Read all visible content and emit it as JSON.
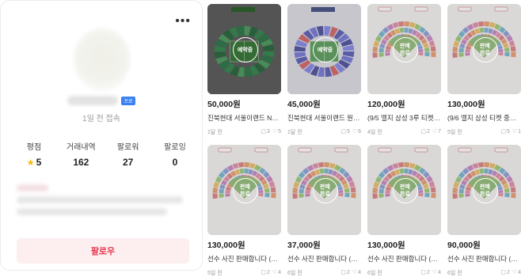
{
  "profile": {
    "menu_icon": "more-horizontal-icon",
    "badge_label": "프로",
    "last_seen": "1일 전 접속",
    "stats": [
      {
        "label": "평점",
        "value": "5",
        "icon": "star-icon"
      },
      {
        "label": "거래내역",
        "value": "162"
      },
      {
        "label": "팔로워",
        "value": "27"
      },
      {
        "label": "팔로잉",
        "value": "0"
      }
    ],
    "follow_label": "팔로우",
    "follow_color": "#e5384f"
  },
  "products": [
    {
      "price": "50,000원",
      "title": "진북현대 서울이랜드 N석 연...",
      "time": "1달 전",
      "chat_count": "3",
      "like_count": "5",
      "status": "예약중",
      "map": "stadium-dark"
    },
    {
      "price": "45,000원",
      "title": "진북현대 서울이랜드 원정석...",
      "time": "1달 전",
      "chat_count": "5",
      "like_count": "6",
      "status": "예약중",
      "map": "stadium-green"
    },
    {
      "price": "120,000원",
      "title": "(9/5 엘지 삼성 3루 티켓 중...",
      "time": "4일 전",
      "chat_count": "2",
      "like_count": "7",
      "status": "판매\n완료",
      "map": "ballpark"
    },
    {
      "price": "130,000원",
      "title": "(9/6 엘지 삼성 티켓 중정)...",
      "time": "5일 전",
      "chat_count": "5",
      "like_count": "1",
      "status": "판매\n완료",
      "map": "ballpark"
    },
    {
      "price": "130,000원",
      "title": "선수 사진 판매합니다 (9/6...",
      "time": "5일 전",
      "chat_count": "2",
      "like_count": "4",
      "status": "판매\n완료",
      "map": "ballpark"
    },
    {
      "price": "37,000원",
      "title": "선수 사진 판매합니다 (9/4...",
      "time": "6일 전",
      "chat_count": "2",
      "like_count": "4",
      "status": "판매\n완료",
      "map": "ballpark"
    },
    {
      "price": "130,000원",
      "title": "선수 사진 판매합니다 (9/4...",
      "time": "6일 전",
      "chat_count": "2",
      "like_count": "4",
      "status": "판매\n완료",
      "map": "ballpark"
    },
    {
      "price": "90,000원",
      "title": "선수 사진 판매합니다 (9/6...",
      "time": "6일 전",
      "chat_count": "2",
      "like_count": "4",
      "status": "판매\n완료",
      "map": "ballpark"
    }
  ],
  "icons": {
    "chat": "chat-bubble-icon",
    "like": "heart-icon"
  }
}
